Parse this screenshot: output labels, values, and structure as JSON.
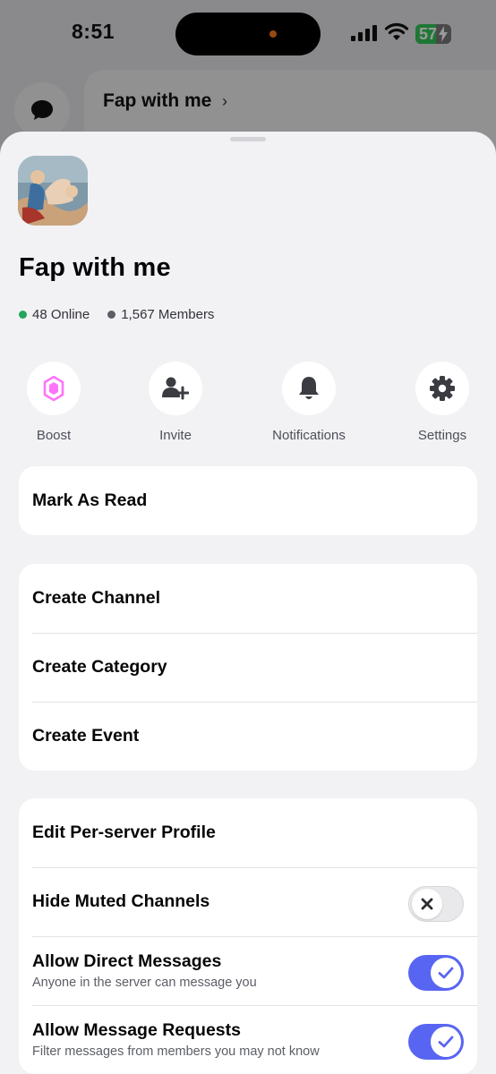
{
  "status_bar": {
    "time": "8:51",
    "battery": "57",
    "battery_level": 0.57
  },
  "background": {
    "server_title": "Fap with me",
    "chevron": "›"
  },
  "server": {
    "name": "Fap with me",
    "online": "48 Online",
    "members": "1,567 Members",
    "online_color": "#23a55a",
    "members_color": "#5c5e66"
  },
  "actions": [
    {
      "label": "Boost",
      "icon": "boost-gem-icon"
    },
    {
      "label": "Invite",
      "icon": "invite-user-icon"
    },
    {
      "label": "Notifications",
      "icon": "bell-icon"
    },
    {
      "label": "Settings",
      "icon": "gear-icon"
    }
  ],
  "group1": [
    {
      "label": "Mark As Read"
    }
  ],
  "group2": [
    {
      "label": "Create Channel"
    },
    {
      "label": "Create Category"
    },
    {
      "label": "Create Event"
    }
  ],
  "group3": [
    {
      "label": "Edit Per-server Profile"
    },
    {
      "label": "Hide Muted Channels",
      "toggle": false
    },
    {
      "label": "Allow Direct Messages",
      "sub": "Anyone in the server can message you",
      "toggle": true
    },
    {
      "label": "Allow Message Requests",
      "sub": "Filter messages from members you may not know",
      "toggle": true
    }
  ],
  "colors": {
    "accent": "#5865f2",
    "boost": "#ff73fa",
    "sheet_bg": "#f2f2f5"
  }
}
